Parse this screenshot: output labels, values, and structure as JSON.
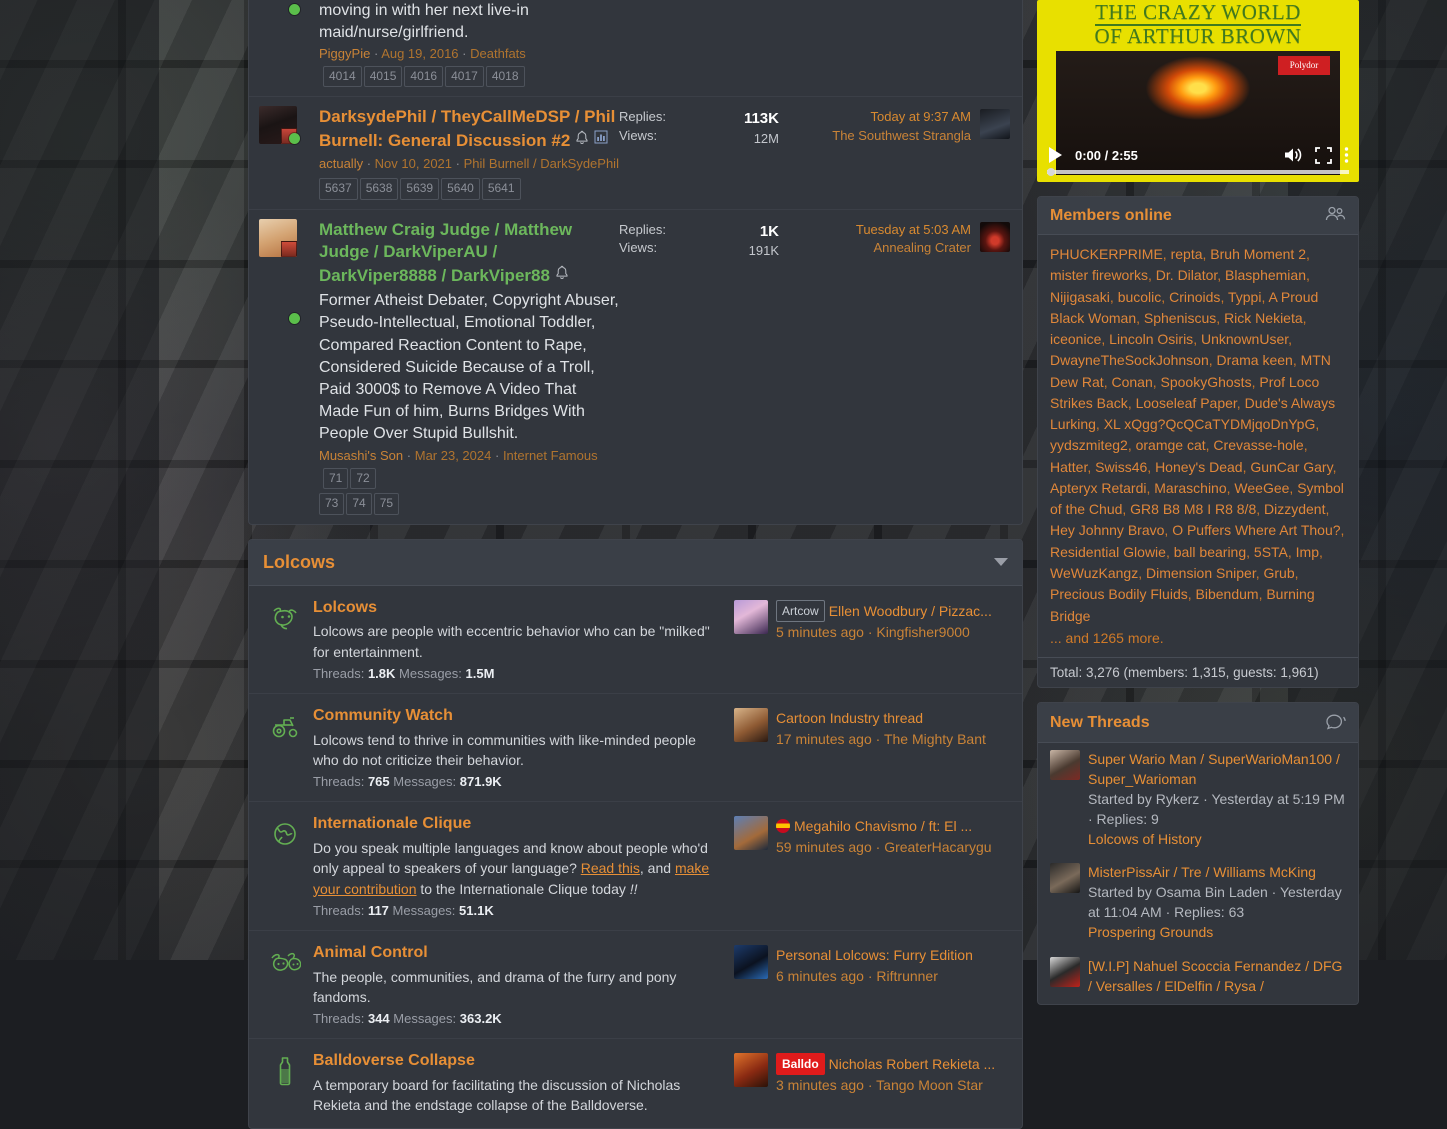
{
  "threads": [
    {
      "title_partial": "moving in with her next live-in maid/nurse/girlfriend.",
      "author": "PiggyPie",
      "date": "Aug 19, 2016",
      "forum": "Deathfats",
      "pages": [
        "4014",
        "4015",
        "4016",
        "4017",
        "4018"
      ],
      "online": true
    },
    {
      "title": "DarksydePhil / TheyCallMeDSP / Phil Burnell: General Discussion #2",
      "author": "actually",
      "date": "Nov 10, 2021",
      "forum": "Phil Burnell / DarkSydePhil",
      "pages": [
        "5637",
        "5638",
        "5639",
        "5640",
        "5641"
      ],
      "replies_label": "Replies:",
      "views_label": "Views:",
      "replies": "113K",
      "views": "12M",
      "last_when": "Today at 9:37 AM",
      "last_who": "The Southwest Strangla",
      "online": true,
      "icons": [
        "bell-icon",
        "poll-icon"
      ],
      "color": "orange"
    },
    {
      "title": "Matthew Craig Judge / Matthew Judge / DarkViperAU / DarkViper8888 / DarkViper88",
      "subtitle": "Former Atheist Debater, Copyright Abuser, Pseudo-Intellectual, Emotional Toddler, Compared Reaction Content to Rape, Considered Suicide Because of a Troll, Paid 3000$ to Remove A Video That Made Fun of him, Burns Bridges With People Over Stupid Bullshit.",
      "author": "Musashi's Son",
      "date": "Mar 23, 2024",
      "forum": "Internet Famous",
      "pages": [
        "71",
        "72",
        "73",
        "74",
        "75"
      ],
      "replies_label": "Replies:",
      "views_label": "Views:",
      "replies": "1K",
      "views": "191K",
      "last_when": "Tuesday at 5:03 AM",
      "last_who": "Annealing Crater",
      "online": true,
      "icons": [
        "bell-icon"
      ],
      "color": "green"
    }
  ],
  "category": {
    "title": "Lolcows",
    "collapse_icon": "chevron-down-icon",
    "nodes": [
      {
        "title": "Lolcows",
        "icon": "cow-head-icon",
        "desc": "Lolcows are people with eccentric behavior who can be \"milked\" for entertainment.",
        "threads_label": "Threads:",
        "threads": "1.8K",
        "messages_label": "Messages:",
        "messages": "1.5M",
        "last_tag": "Artcow",
        "last_title": "Ellen Woodbury / Pizzac...",
        "last_time": "5 minutes ago",
        "last_user": "Kingfisher9000"
      },
      {
        "title": "Community Watch",
        "icon": "tractor-icon",
        "desc": "Lolcows tend to thrive in communities with like-minded people who do not criticize their behavior.",
        "threads_label": "Threads:",
        "threads": "765",
        "messages_label": "Messages:",
        "messages": "871.9K",
        "last_title": "Cartoon Industry thread",
        "last_time": "17 minutes ago",
        "last_user": "The Mighty Bant"
      },
      {
        "title": "Internationale Clique",
        "icon": "globe-icon",
        "desc_parts": {
          "p1": "Do you speak multiple languages and know about people who'd only appeal to speakers of your language? ",
          "link1": "Read this",
          "p2": ", and ",
          "link2": "make your contribution",
          "p3": " to the Internationale Clique today ",
          "em": "!!"
        },
        "threads_label": "Threads:",
        "threads": "117",
        "messages_label": "Messages:",
        "messages": "51.1K",
        "last_flag": "spain-flag-icon",
        "last_title": "Megahilo Chavismo / ft: El ...",
        "last_time": "59 minutes ago",
        "last_user": "GreaterHacarygu"
      },
      {
        "title": "Animal Control",
        "icon": "two-cows-icon",
        "desc": "The people, communities, and drama of the furry and pony fandoms.",
        "threads_label": "Threads:",
        "threads": "344",
        "messages_label": "Messages:",
        "messages": "363.2K",
        "last_title": "Personal Lolcows: Furry Edition",
        "last_time": "6 minutes ago",
        "last_user": "Riftrunner"
      },
      {
        "title": "Balldoverse Collapse",
        "icon": "bottle-icon",
        "desc": "A temporary board for facilitating the discussion of Nicholas Rekieta and the endstage collapse of the Balldoverse.",
        "last_tag": "Balldo",
        "last_title": "Nicholas Robert Rekieta ...",
        "last_time": "3 minutes ago",
        "last_user": "Tango Moon Star"
      }
    ]
  },
  "video": {
    "title_line1": "THE CRAZY WORLD",
    "title_line2": "OF ARTHUR BROWN",
    "label": "Polydor",
    "time": "0:00 / 2:55",
    "play_icon": "play-icon",
    "volume_icon": "volume-icon",
    "fullscreen_icon": "fullscreen-icon",
    "menu_icon": "kebab-menu-icon"
  },
  "members_online": {
    "title": "Members online",
    "icon": "people-icon",
    "names": [
      "PHUCKERPRIME",
      "repta",
      "Bruh Moment 2",
      "mister fireworks",
      "Dr. Dilator",
      "Blasphemian",
      "Nijigasaki",
      "bucolic",
      "Crinoids",
      "Typpi",
      "A Proud Black Woman",
      "Spheniscus",
      "Rick Nekieta",
      "iceonice",
      "Lincoln Osiris",
      "UnknownUser",
      "DwayneTheSockJohnson",
      "Drama keen",
      "MTN Dew Rat",
      "Conan",
      "SpookyGhosts",
      "Prof Loco Strikes Back",
      "Looseleaf Paper",
      "Dude's Always Lurking",
      "XL xQgg?QcQCaTYDMjqoDnYpG",
      "yydszmiteg2",
      "oramge cat",
      "Crevasse-hole",
      "Hatter",
      "Swiss46",
      "Honey's Dead",
      "GunCar Gary",
      "Apteryx Retardi",
      "Maraschino",
      "WeeGee",
      "Symbol of the Chud",
      "GR8 B8 M8 I R8 8/8",
      "Dizzydent",
      "Hey Johnny Bravo",
      "O Puffers Where Art Thou?",
      "Residential Glowie",
      "ball bearing",
      "5STA",
      "Imp",
      "WeWuzKangz",
      "Dimension Sniper",
      "Grub",
      "Precious Bodily Fluids",
      "Bibendum",
      "Burning Bridge"
    ],
    "more": "... and 1265 more.",
    "total": "Total: 3,276 (members: 1,315, guests: 1,961)"
  },
  "new_threads": {
    "title": "New Threads",
    "icon": "comment-bubbles-icon",
    "items": [
      {
        "title": "Super Wario Man / SuperWarioMan100 / Super_Warioman",
        "meta": "Started by Rykerz · Yesterday at 5:19 PM · Replies: 9",
        "node": "Lolcows of History"
      },
      {
        "title": "MisterPissAir / Tre / Williams McKing",
        "meta": "Started by Osama Bin Laden · Yesterday at 11:04 AM · Replies: 63",
        "node": "Prospering Grounds"
      },
      {
        "title": "[W.I.P] Nahuel Scoccia Fernandez / DFG / Versalles / ElDelfin / Rysa /",
        "meta": "",
        "node": ""
      }
    ]
  },
  "colors": {
    "accent": "#e78f36",
    "green": "#6cb75c",
    "panel": "#32363d",
    "header": "#3a3f47"
  }
}
